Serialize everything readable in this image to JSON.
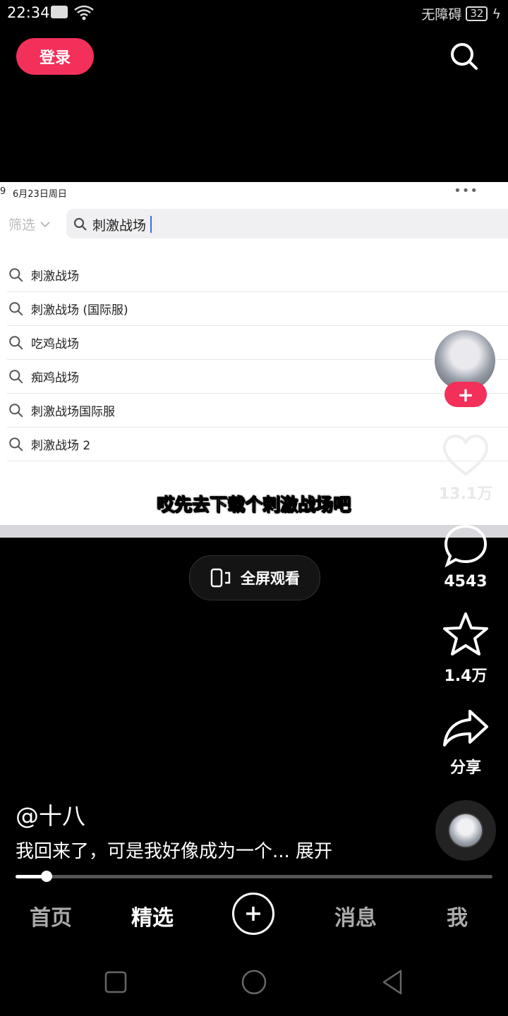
{
  "status_bar": {
    "time": "22:34",
    "accessibility": "无障碍",
    "battery": "32"
  },
  "header": {
    "login_label": "登录"
  },
  "video": {
    "date_prefix": "9",
    "date": "6月23日周日",
    "dots": "•••",
    "filter_label": "筛选",
    "search_query": "刺激战场",
    "suggestions": [
      "刺激战场",
      "刺激战场 (国际服)",
      "吃鸡战场",
      "痴鸡战场",
      "刺激战场国际服",
      "刺激战场 2"
    ],
    "subtitle": "哎先去下载个刺激战场吧"
  },
  "fullscreen_label": "全屏观看",
  "sidebar": {
    "follow_label": "+",
    "likes": "13.1万",
    "comments": "4543",
    "favorites": "1.4万",
    "share_label": "分享"
  },
  "post": {
    "author": "@十八",
    "description": "我回来了，可是我好像成为一个... 展开",
    "progress": 0.065
  },
  "tabs": [
    "首页",
    "精选",
    "消息",
    "我"
  ],
  "icons": [
    "search-icon",
    "heart-icon",
    "comment-icon",
    "star-icon",
    "share-icon",
    "plus-icon",
    "phone-rotate-icon",
    "music-disc-icon"
  ]
}
